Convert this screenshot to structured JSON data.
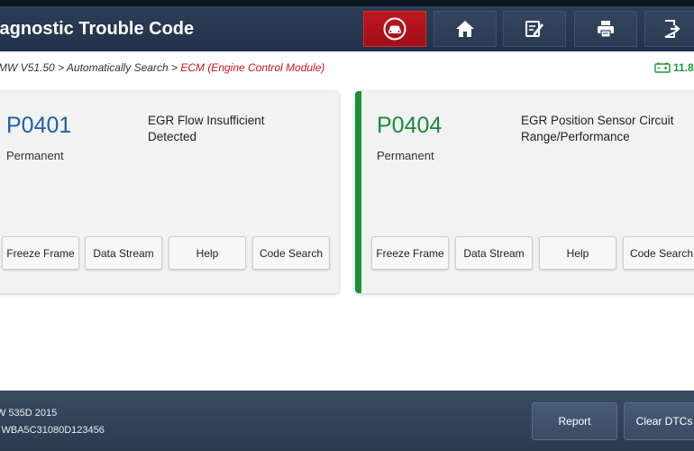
{
  "header": {
    "title": "iagnostic Trouble Code",
    "buttons": [
      {
        "icon": "car-icon",
        "active": true
      },
      {
        "icon": "home-icon",
        "active": false
      },
      {
        "icon": "edit-icon",
        "active": false
      },
      {
        "icon": "print-icon",
        "active": false
      },
      {
        "icon": "exit-icon",
        "active": false
      }
    ]
  },
  "breadcrumb": {
    "path": "MW V51.50 > Automatically Search > ",
    "module": "ECM (Engine Control Module)"
  },
  "battery": {
    "icon": "battery-icon",
    "value": "11.8"
  },
  "dtcs": [
    {
      "code": "P0401",
      "status": "Permanent",
      "description": "EGR Flow Insufficient Detected",
      "code_color": "#1f5ea8",
      "selected": false,
      "buttons": [
        "Freeze Frame",
        "Data Stream",
        "Help",
        "Code Search"
      ]
    },
    {
      "code": "P0404",
      "status": "Permanent",
      "description": "EGR Position Sensor Circuit Range/Performance",
      "code_color": "#1a8a3e",
      "selected": true,
      "buttons": [
        "Freeze Frame",
        "Data Stream",
        "Help",
        "Code Search"
      ]
    }
  ],
  "footer": {
    "vehicle": "W 535D 2015",
    "vin": "l WBA5C31080D123456",
    "report_label": "Report",
    "clear_label": "Clear DTCs"
  },
  "colors": {
    "header_bg": "#2a3b53",
    "active_button": "#c0161f",
    "accent_green": "#1a9040",
    "crumb_module": "#c8141c"
  }
}
